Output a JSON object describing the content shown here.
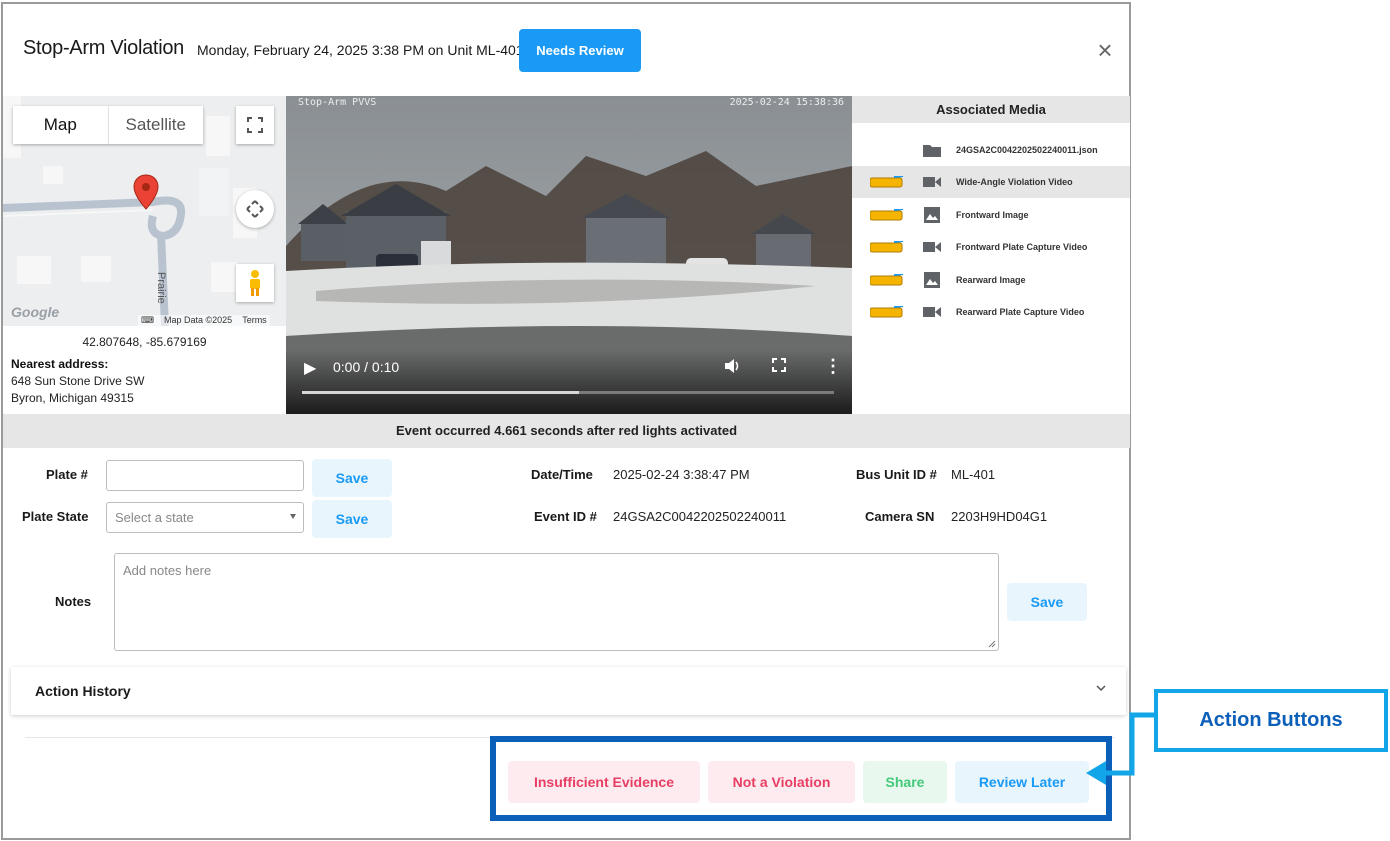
{
  "header": {
    "title": "Stop-Arm Violation",
    "subtitle": "Monday, February 24, 2025 3:38 PM on Unit ML-401",
    "status_button": "Needs Review",
    "close_glyph": "×"
  },
  "map": {
    "tabs": [
      "Map",
      "Satellite"
    ],
    "street_label": "Prairie",
    "google_logo": "Google",
    "map_data": "Map Data ©2025",
    "terms": "Terms",
    "coordinates": "42.807648, -85.679169",
    "nearest_label": "Nearest address:",
    "address_line1": "648 Sun Stone Drive SW",
    "address_line2": "Byron, Michigan 49315"
  },
  "video": {
    "overlay_left": "Stop-Arm PVVS",
    "overlay_right": "2025-02-24 15:38:36",
    "time": "0:00 / 0:10",
    "progress_fraction": 0.0,
    "buffered_fraction": 0.52
  },
  "media": {
    "heading": "Associated Media",
    "items": [
      {
        "label": "24GSA2C0042202502240011.json",
        "type": "folder-icon",
        "schedule": false,
        "selected": false
      },
      {
        "label": "Wide-Angle Violation Video",
        "type": "video-icon",
        "schedule": true,
        "selected": true
      },
      {
        "label": "Frontward Image",
        "type": "image-icon",
        "schedule": true,
        "selected": false
      },
      {
        "label": "Frontward Plate Capture Video",
        "type": "video-icon",
        "schedule": true,
        "selected": false
      },
      {
        "label": "Rearward Image",
        "type": "image-icon",
        "schedule": true,
        "selected": false
      },
      {
        "label": "Rearward Plate Capture Video",
        "type": "video-icon",
        "schedule": true,
        "selected": false
      }
    ]
  },
  "event_bar": "Event occurred 4.661 seconds after red lights activated",
  "form": {
    "plate_label": "Plate #",
    "plate_value": "",
    "plate_state_label": "Plate State",
    "plate_state_placeholder": "Select a state",
    "save_label": "Save",
    "notes_label": "Notes",
    "notes_placeholder": "Add notes here"
  },
  "details": {
    "datetime_label": "Date/Time",
    "datetime_value": "2025-02-24 3:38:47 PM",
    "event_id_label": "Event ID #",
    "event_id_value": "24GSA2C0042202502240011",
    "bus_unit_label": "Bus Unit ID #",
    "bus_unit_value": "ML-401",
    "camera_sn_label": "Camera SN",
    "camera_sn_value": "2203H9HD04G1"
  },
  "action_history": "Action History",
  "actions": {
    "insufficient": "Insufficient Evidence",
    "not_violation": "Not a Violation",
    "share": "Share",
    "review_later": "Review Later"
  },
  "annotation": "Action Buttons",
  "colors": {
    "primary": "#1a9af5",
    "danger": "#e83e64",
    "success": "#43c97a",
    "annotation_dark": "#0b5fb8",
    "annotation_light": "#12a6e8"
  }
}
